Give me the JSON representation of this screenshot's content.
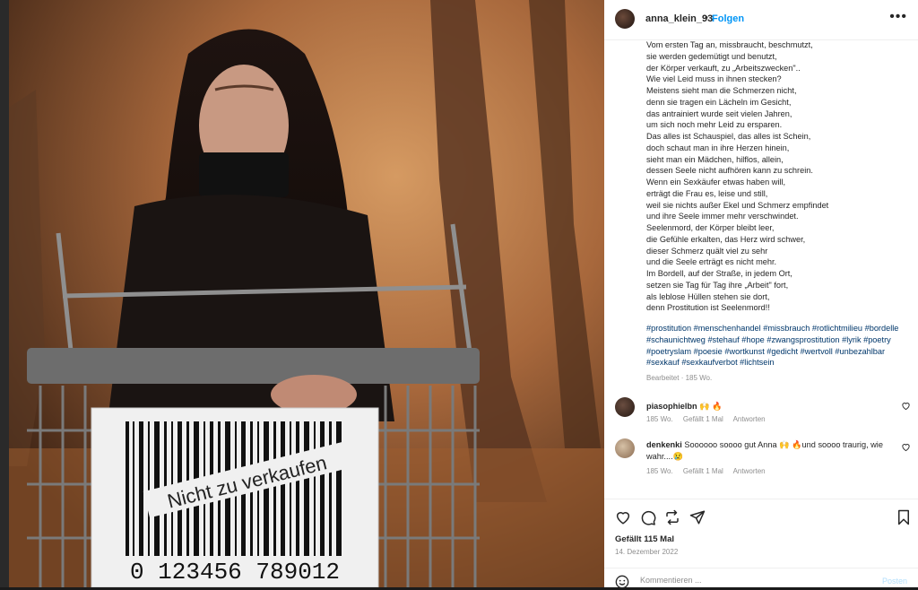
{
  "post": {
    "username": "anna_klein_93",
    "separator": "•",
    "follow_label": "Folgen",
    "more_icon": "more-icon",
    "caption": "Vom ersten Tag an, missbraucht, beschmutzt,\nsie werden gedemütigt und benutzt,\nder Körper verkauft, zu „Arbeitszwecken\"..\nWie viel Leid muss in ihnen stecken?\nMeistens sieht man die Schmerzen nicht,\ndenn sie tragen ein Lächeln im Gesicht,\ndas antrainiert wurde seit vielen Jahren,\num sich noch mehr Leid zu ersparen.\nDas alles ist Schauspiel, das alles ist Schein,\ndoch schaut man in ihre Herzen hinein,\nsieht man ein Mädchen, hilflos, allein,\ndessen Seele nicht aufhören kann zu schrein.\nWenn ein Sexkäufer etwas haben will,\nerträgt die Frau es, leise und still,\nweil sie nichts außer Ekel und Schmerz empfindet\nund ihre Seele immer mehr verschwindet.\nSeelenmord, der Körper bleibt leer,\ndie Gefühle erkalten, das Herz wird schwer,\ndieser Schmerz quält viel zu sehr\nund die Seele erträgt es nicht mehr.\nIm Bordell, auf der Straße, in jedem Ort,\nsetzen sie Tag für Tag ihre „Arbeit\" fort,\nals leblose Hüllen stehen sie dort,\ndenn Prostitution ist Seelenmord!!",
    "hashtags": "#prostitution #menschenhandel #missbrauch #rotlichtmilieu #bordelle #schaunichtweg #stehauf #hope #zwangsprostitution #lyrik #poetry #poetryslam #poesie #wortkunst #gedicht #wertvoll #unbezahlbar #sexkauf #sexkaufverbot #lichtsein",
    "edited_label": "Bearbeitet · 185 Wo.",
    "likes": "Gefällt 115 Mal",
    "date": "14. Dezember 2022"
  },
  "image": {
    "sign_text": "Nicht zu verkaufen",
    "barcode_number": "0  123456  789012"
  },
  "comments": [
    {
      "username": "piasophielbn",
      "text": " 🙌 🔥",
      "age": "185 Wo.",
      "likes": "Gefällt 1 Mal",
      "reply": "Antworten",
      "avatar_color": "#3a2a22"
    },
    {
      "username": "denkenki",
      "text": " Soooooo soooo gut Anna 🙌 🔥und soooo traurig, wie wahr....😢",
      "age": "185 Wo.",
      "likes": "Gefällt 1 Mal",
      "reply": "Antworten",
      "avatar_color": "#b89a7a"
    }
  ],
  "comment_box": {
    "placeholder": "Kommentieren ...",
    "post_label": "Posten"
  },
  "colors": {
    "link": "#0095f6",
    "hashtag": "#00376b",
    "muted": "#8e8e8e"
  }
}
